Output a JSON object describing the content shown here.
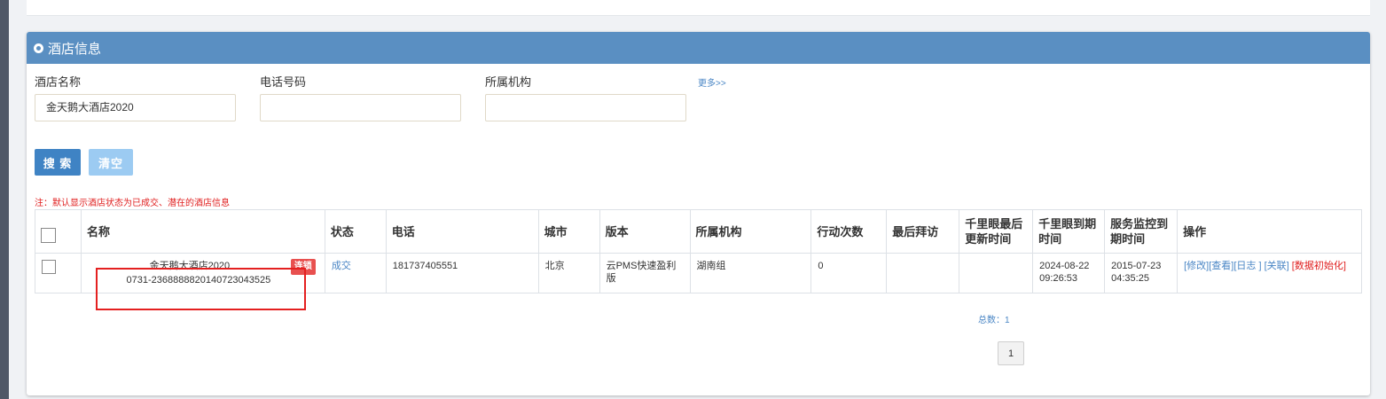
{
  "panel": {
    "title": "酒店信息"
  },
  "filters": {
    "hotel_name_label": "酒店名称",
    "hotel_name_value": "金天鹅大酒店2020",
    "phone_label": "电话号码",
    "phone_value": "",
    "org_label": "所属机构",
    "org_value": "",
    "more_label": "更多>>"
  },
  "buttons": {
    "search": "搜 索",
    "clear": "清空"
  },
  "note": "注：默认显示酒店状态为已成交、潜在的酒店信息",
  "table": {
    "headers": [
      "名称",
      "状态",
      "电话",
      "城市",
      "版本",
      "所属机构",
      "行动次数",
      "最后拜访",
      "千里眼最后更新时间",
      "千里眼到期时间",
      "服务监控到期时间",
      "操作"
    ],
    "rows": [
      {
        "name": "金天鹅大酒店2020",
        "name_code": "0731-236888882014072304352​5",
        "badge": "连锁",
        "status": "成交",
        "phone": "18173740​5551",
        "city": "北京",
        "version": "云PMS快速盈利版",
        "org": "湖南组",
        "actions": "0",
        "last_visit": "",
        "qly_update": "",
        "qly_expire": "2024-08-22 09:26:53",
        "monitor_expire": "2015-07-23 04:35:25",
        "ops": {
          "edit": "[修改]",
          "view": "[查看]",
          "log": "[日志 ]",
          "link": "[关联]",
          "init": "[数据初始化]"
        }
      }
    ]
  },
  "pagination": {
    "total_label": "总数：1",
    "current_page": "1"
  }
}
